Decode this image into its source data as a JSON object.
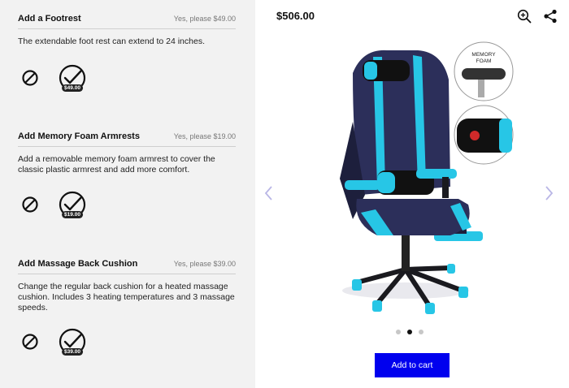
{
  "options": [
    {
      "title": "Add a Footrest",
      "price_note": "Yes, please  $49.00",
      "description": "The extendable foot rest can extend to 24 inches.",
      "badge": "$49.00"
    },
    {
      "title": "Add Memory Foam Armrests",
      "price_note": "Yes, please  $19.00",
      "description": "Add a removable memory foam armrest to cover the classic plastic armrest and add more comfort.",
      "badge": "$19.00"
    },
    {
      "title": "Add Massage Back Cushion",
      "price_note": "Yes, please  $39.00",
      "description": "Change the regular back cushion for a heated massage cushion. Includes 3 heating temperatures and 3 massage speeds.",
      "badge": "$39.00"
    }
  ],
  "product": {
    "price": "$506.00",
    "image_label": "MEMORY FOAM",
    "accent_color": "#27c6e6",
    "base_color": "#2c2f5a",
    "carousel": {
      "current": 2,
      "total": 3
    },
    "add_to_cart": "Add to cart",
    "button_color": "#0000ee"
  },
  "icons": [
    "no-option-icon",
    "check-option-icon",
    "zoom-in-icon",
    "share-icon",
    "chevron-left-icon",
    "chevron-right-icon"
  ]
}
